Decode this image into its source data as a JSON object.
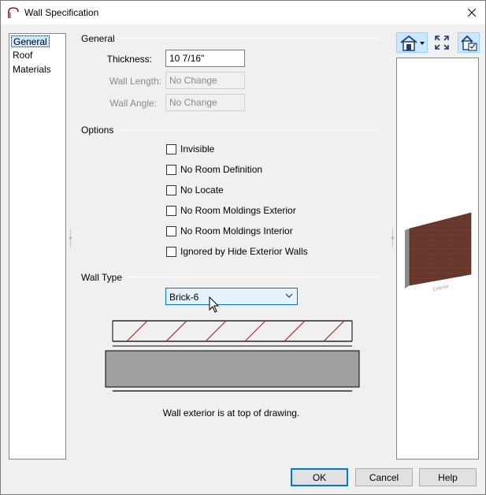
{
  "window": {
    "title": "Wall Specification"
  },
  "nav": {
    "items": [
      {
        "label": "General",
        "selected": true
      },
      {
        "label": "Roof",
        "selected": false
      },
      {
        "label": "Materials",
        "selected": false
      }
    ]
  },
  "general": {
    "heading": "General",
    "thickness_label": "Thickness:",
    "thickness_value": "10 7/16\"",
    "wall_length_label": "Wall Length:",
    "wall_length_value": "No Change",
    "wall_angle_label": "Wall Angle:",
    "wall_angle_value": "No Change"
  },
  "options": {
    "heading": "Options",
    "checkboxes": [
      {
        "label": "Invisible",
        "checked": false
      },
      {
        "label": "No Room Definition",
        "checked": false
      },
      {
        "label": "No Locate",
        "checked": false
      },
      {
        "label": "No Room Moldings Exterior",
        "checked": false
      },
      {
        "label": "No Room Moldings Interior",
        "checked": false
      },
      {
        "label": "Ignored by Hide Exterior Walls",
        "checked": false
      }
    ]
  },
  "wall_type": {
    "heading": "Wall Type",
    "selected": "Brick-6",
    "caption": "Wall exterior is at top of drawing."
  },
  "preview": {
    "wall_label": "Exterior"
  },
  "buttons": {
    "ok": "OK",
    "cancel": "Cancel",
    "help": "Help"
  },
  "colors": {
    "accent": "#0078d7",
    "brick": "#6b3a2e",
    "hatch": "#cc0000",
    "core": "#a0a0a0"
  }
}
